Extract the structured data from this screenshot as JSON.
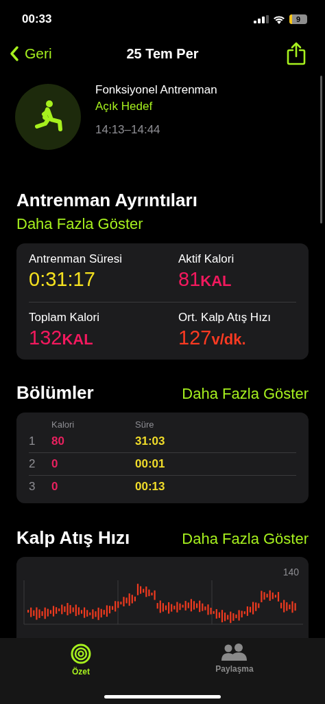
{
  "status_bar": {
    "time": "00:33",
    "battery": "9"
  },
  "nav": {
    "back": "Geri",
    "title": "25 Tem Per"
  },
  "workout": {
    "name": "Fonksiyonel Antrenman",
    "goal": "Açık Hedef",
    "time_range": "14:13–14:44"
  },
  "details": {
    "title": "Antrenman Ayrıntıları",
    "more": "Daha Fazla Göster",
    "metrics": [
      {
        "label": "Antrenman Süresi",
        "value": "0:31:17",
        "color": "#f4e01f"
      },
      {
        "label": "Aktif Kalori",
        "value": "81",
        "unit": "KAL",
        "color": "#f2195e"
      },
      {
        "label": "Toplam Kalori",
        "value": "132",
        "unit": "KAL",
        "color": "#f2195e"
      },
      {
        "label": "Ort. Kalp Atış Hızı",
        "value": "127",
        "unit": "v/dk.",
        "color": "#fb3a22"
      }
    ]
  },
  "segments": {
    "title": "Bölümler",
    "more": "Daha Fazla Göster",
    "columns": [
      {
        "label": "Kalori",
        "color": "#e8215f"
      },
      {
        "label": "Süre",
        "color": "#f0dc2a"
      }
    ],
    "rows": [
      {
        "index": "1",
        "cells": [
          "80",
          "31:03"
        ]
      },
      {
        "index": "2",
        "cells": [
          "0",
          "00:01"
        ]
      },
      {
        "index": "3",
        "cells": [
          "0",
          "00:13"
        ]
      }
    ]
  },
  "heart_rate": {
    "title": "Kalp Atış Hızı",
    "more": "Daha Fazla Göster",
    "axis_label": "140"
  },
  "tab_bar": [
    {
      "label": "Özet",
      "kind": "rings",
      "selected": true
    },
    {
      "label": "Paylaşma",
      "kind": "people",
      "selected": false
    }
  ]
}
